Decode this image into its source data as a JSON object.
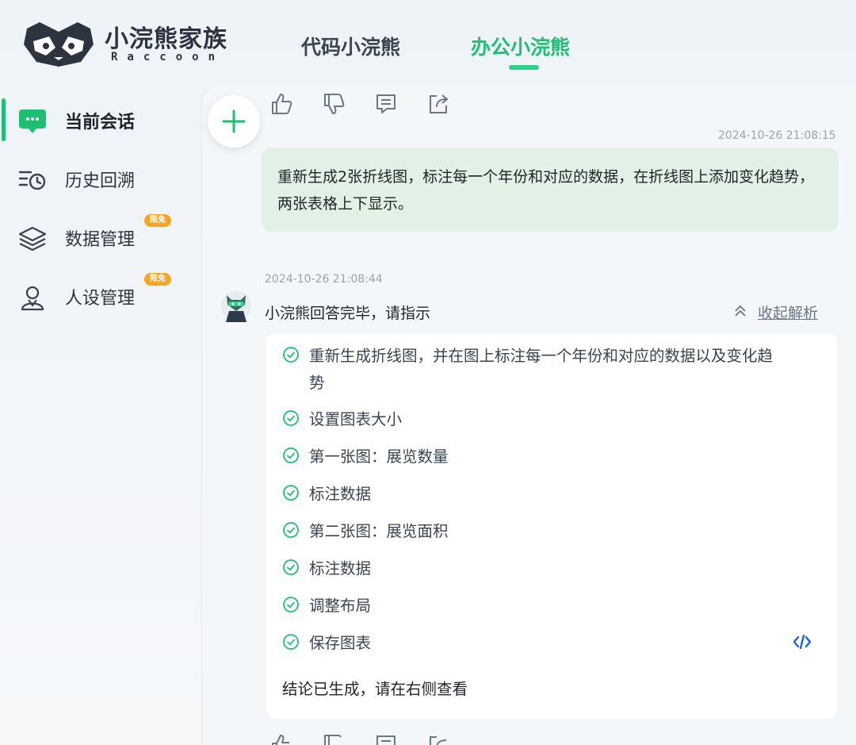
{
  "header": {
    "brand_name": "小浣熊家族",
    "brand_sub": "Raccoon",
    "tabs": [
      {
        "label": "代码小浣熊",
        "active": false
      },
      {
        "label": "办公小浣熊",
        "active": true
      }
    ],
    "accent": "#1fbf73"
  },
  "sidebar": {
    "items": [
      {
        "label": "当前会话",
        "icon": "chat-icon",
        "active": true
      },
      {
        "label": "历史回溯",
        "icon": "history-icon",
        "active": false
      },
      {
        "label": "数据管理",
        "icon": "layers-icon",
        "active": false,
        "badge": "限免"
      },
      {
        "label": "人设管理",
        "icon": "person-icon",
        "active": false,
        "badge": "限免"
      }
    ]
  },
  "chat": {
    "new_button_icon": "plus-icon",
    "actions": [
      "thumbs-up-icon",
      "thumbs-down-icon",
      "comment-icon",
      "share-icon"
    ],
    "user_message": {
      "timestamp": "2024-10-26 21:08:15",
      "text": "重新生成2张折线图，标注每一个年份和对应的数据，在折线图上添加变化趋势，两张表格上下显示。"
    },
    "bot_message": {
      "timestamp": "2024-10-26 21:08:44",
      "title": "小浣熊回答完毕，请指示",
      "collapse_label": "收起解析",
      "steps": [
        "重新生成折线图，并在图上标注每一个年份和对应的数据以及变化趋势",
        "设置图表大小",
        "第一张图：展览数量",
        "标注数据",
        "第二张图：展览面积",
        "标注数据",
        "调整布局",
        "保存图表"
      ],
      "conclusion": "结论已生成，请在右侧查看"
    }
  }
}
